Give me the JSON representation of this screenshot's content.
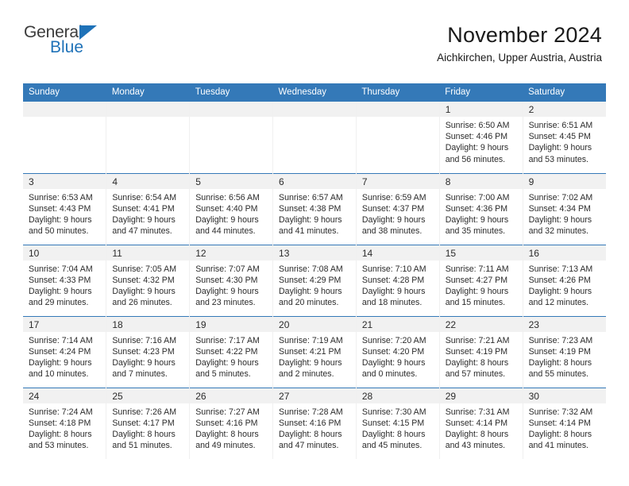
{
  "brand": {
    "name_part1": "General",
    "name_part2": "Blue",
    "accent_color": "#1f72b8",
    "triangle_icon": "logo-triangle-icon"
  },
  "header": {
    "title": "November 2024",
    "subtitle": "Aichkirchen, Upper Austria, Austria"
  },
  "theme": {
    "header_bg": "#3479b8",
    "row_divider": "#3479b8",
    "daynum_band_bg": "#f1f1f1",
    "text": "#2b2b2b"
  },
  "calendar": {
    "columns": [
      "Sunday",
      "Monday",
      "Tuesday",
      "Wednesday",
      "Thursday",
      "Friday",
      "Saturday"
    ],
    "weeks": [
      [
        {
          "day": "",
          "empty": true,
          "sunrise": "",
          "sunset": "",
          "daylight_l1": "",
          "daylight_l2": ""
        },
        {
          "day": "",
          "empty": true,
          "sunrise": "",
          "sunset": "",
          "daylight_l1": "",
          "daylight_l2": ""
        },
        {
          "day": "",
          "empty": true,
          "sunrise": "",
          "sunset": "",
          "daylight_l1": "",
          "daylight_l2": ""
        },
        {
          "day": "",
          "empty": true,
          "sunrise": "",
          "sunset": "",
          "daylight_l1": "",
          "daylight_l2": ""
        },
        {
          "day": "",
          "empty": true,
          "sunrise": "",
          "sunset": "",
          "daylight_l1": "",
          "daylight_l2": ""
        },
        {
          "day": "1",
          "empty": false,
          "sunrise": "Sunrise: 6:50 AM",
          "sunset": "Sunset: 4:46 PM",
          "daylight_l1": "Daylight: 9 hours",
          "daylight_l2": "and 56 minutes."
        },
        {
          "day": "2",
          "empty": false,
          "sunrise": "Sunrise: 6:51 AM",
          "sunset": "Sunset: 4:45 PM",
          "daylight_l1": "Daylight: 9 hours",
          "daylight_l2": "and 53 minutes."
        }
      ],
      [
        {
          "day": "3",
          "empty": false,
          "sunrise": "Sunrise: 6:53 AM",
          "sunset": "Sunset: 4:43 PM",
          "daylight_l1": "Daylight: 9 hours",
          "daylight_l2": "and 50 minutes."
        },
        {
          "day": "4",
          "empty": false,
          "sunrise": "Sunrise: 6:54 AM",
          "sunset": "Sunset: 4:41 PM",
          "daylight_l1": "Daylight: 9 hours",
          "daylight_l2": "and 47 minutes."
        },
        {
          "day": "5",
          "empty": false,
          "sunrise": "Sunrise: 6:56 AM",
          "sunset": "Sunset: 4:40 PM",
          "daylight_l1": "Daylight: 9 hours",
          "daylight_l2": "and 44 minutes."
        },
        {
          "day": "6",
          "empty": false,
          "sunrise": "Sunrise: 6:57 AM",
          "sunset": "Sunset: 4:38 PM",
          "daylight_l1": "Daylight: 9 hours",
          "daylight_l2": "and 41 minutes."
        },
        {
          "day": "7",
          "empty": false,
          "sunrise": "Sunrise: 6:59 AM",
          "sunset": "Sunset: 4:37 PM",
          "daylight_l1": "Daylight: 9 hours",
          "daylight_l2": "and 38 minutes."
        },
        {
          "day": "8",
          "empty": false,
          "sunrise": "Sunrise: 7:00 AM",
          "sunset": "Sunset: 4:36 PM",
          "daylight_l1": "Daylight: 9 hours",
          "daylight_l2": "and 35 minutes."
        },
        {
          "day": "9",
          "empty": false,
          "sunrise": "Sunrise: 7:02 AM",
          "sunset": "Sunset: 4:34 PM",
          "daylight_l1": "Daylight: 9 hours",
          "daylight_l2": "and 32 minutes."
        }
      ],
      [
        {
          "day": "10",
          "empty": false,
          "sunrise": "Sunrise: 7:04 AM",
          "sunset": "Sunset: 4:33 PM",
          "daylight_l1": "Daylight: 9 hours",
          "daylight_l2": "and 29 minutes."
        },
        {
          "day": "11",
          "empty": false,
          "sunrise": "Sunrise: 7:05 AM",
          "sunset": "Sunset: 4:32 PM",
          "daylight_l1": "Daylight: 9 hours",
          "daylight_l2": "and 26 minutes."
        },
        {
          "day": "12",
          "empty": false,
          "sunrise": "Sunrise: 7:07 AM",
          "sunset": "Sunset: 4:30 PM",
          "daylight_l1": "Daylight: 9 hours",
          "daylight_l2": "and 23 minutes."
        },
        {
          "day": "13",
          "empty": false,
          "sunrise": "Sunrise: 7:08 AM",
          "sunset": "Sunset: 4:29 PM",
          "daylight_l1": "Daylight: 9 hours",
          "daylight_l2": "and 20 minutes."
        },
        {
          "day": "14",
          "empty": false,
          "sunrise": "Sunrise: 7:10 AM",
          "sunset": "Sunset: 4:28 PM",
          "daylight_l1": "Daylight: 9 hours",
          "daylight_l2": "and 18 minutes."
        },
        {
          "day": "15",
          "empty": false,
          "sunrise": "Sunrise: 7:11 AM",
          "sunset": "Sunset: 4:27 PM",
          "daylight_l1": "Daylight: 9 hours",
          "daylight_l2": "and 15 minutes."
        },
        {
          "day": "16",
          "empty": false,
          "sunrise": "Sunrise: 7:13 AM",
          "sunset": "Sunset: 4:26 PM",
          "daylight_l1": "Daylight: 9 hours",
          "daylight_l2": "and 12 minutes."
        }
      ],
      [
        {
          "day": "17",
          "empty": false,
          "sunrise": "Sunrise: 7:14 AM",
          "sunset": "Sunset: 4:24 PM",
          "daylight_l1": "Daylight: 9 hours",
          "daylight_l2": "and 10 minutes."
        },
        {
          "day": "18",
          "empty": false,
          "sunrise": "Sunrise: 7:16 AM",
          "sunset": "Sunset: 4:23 PM",
          "daylight_l1": "Daylight: 9 hours",
          "daylight_l2": "and 7 minutes."
        },
        {
          "day": "19",
          "empty": false,
          "sunrise": "Sunrise: 7:17 AM",
          "sunset": "Sunset: 4:22 PM",
          "daylight_l1": "Daylight: 9 hours",
          "daylight_l2": "and 5 minutes."
        },
        {
          "day": "20",
          "empty": false,
          "sunrise": "Sunrise: 7:19 AM",
          "sunset": "Sunset: 4:21 PM",
          "daylight_l1": "Daylight: 9 hours",
          "daylight_l2": "and 2 minutes."
        },
        {
          "day": "21",
          "empty": false,
          "sunrise": "Sunrise: 7:20 AM",
          "sunset": "Sunset: 4:20 PM",
          "daylight_l1": "Daylight: 9 hours",
          "daylight_l2": "and 0 minutes."
        },
        {
          "day": "22",
          "empty": false,
          "sunrise": "Sunrise: 7:21 AM",
          "sunset": "Sunset: 4:19 PM",
          "daylight_l1": "Daylight: 8 hours",
          "daylight_l2": "and 57 minutes."
        },
        {
          "day": "23",
          "empty": false,
          "sunrise": "Sunrise: 7:23 AM",
          "sunset": "Sunset: 4:19 PM",
          "daylight_l1": "Daylight: 8 hours",
          "daylight_l2": "and 55 minutes."
        }
      ],
      [
        {
          "day": "24",
          "empty": false,
          "sunrise": "Sunrise: 7:24 AM",
          "sunset": "Sunset: 4:18 PM",
          "daylight_l1": "Daylight: 8 hours",
          "daylight_l2": "and 53 minutes."
        },
        {
          "day": "25",
          "empty": false,
          "sunrise": "Sunrise: 7:26 AM",
          "sunset": "Sunset: 4:17 PM",
          "daylight_l1": "Daylight: 8 hours",
          "daylight_l2": "and 51 minutes."
        },
        {
          "day": "26",
          "empty": false,
          "sunrise": "Sunrise: 7:27 AM",
          "sunset": "Sunset: 4:16 PM",
          "daylight_l1": "Daylight: 8 hours",
          "daylight_l2": "and 49 minutes."
        },
        {
          "day": "27",
          "empty": false,
          "sunrise": "Sunrise: 7:28 AM",
          "sunset": "Sunset: 4:16 PM",
          "daylight_l1": "Daylight: 8 hours",
          "daylight_l2": "and 47 minutes."
        },
        {
          "day": "28",
          "empty": false,
          "sunrise": "Sunrise: 7:30 AM",
          "sunset": "Sunset: 4:15 PM",
          "daylight_l1": "Daylight: 8 hours",
          "daylight_l2": "and 45 minutes."
        },
        {
          "day": "29",
          "empty": false,
          "sunrise": "Sunrise: 7:31 AM",
          "sunset": "Sunset: 4:14 PM",
          "daylight_l1": "Daylight: 8 hours",
          "daylight_l2": "and 43 minutes."
        },
        {
          "day": "30",
          "empty": false,
          "sunrise": "Sunrise: 7:32 AM",
          "sunset": "Sunset: 4:14 PM",
          "daylight_l1": "Daylight: 8 hours",
          "daylight_l2": "and 41 minutes."
        }
      ]
    ]
  }
}
